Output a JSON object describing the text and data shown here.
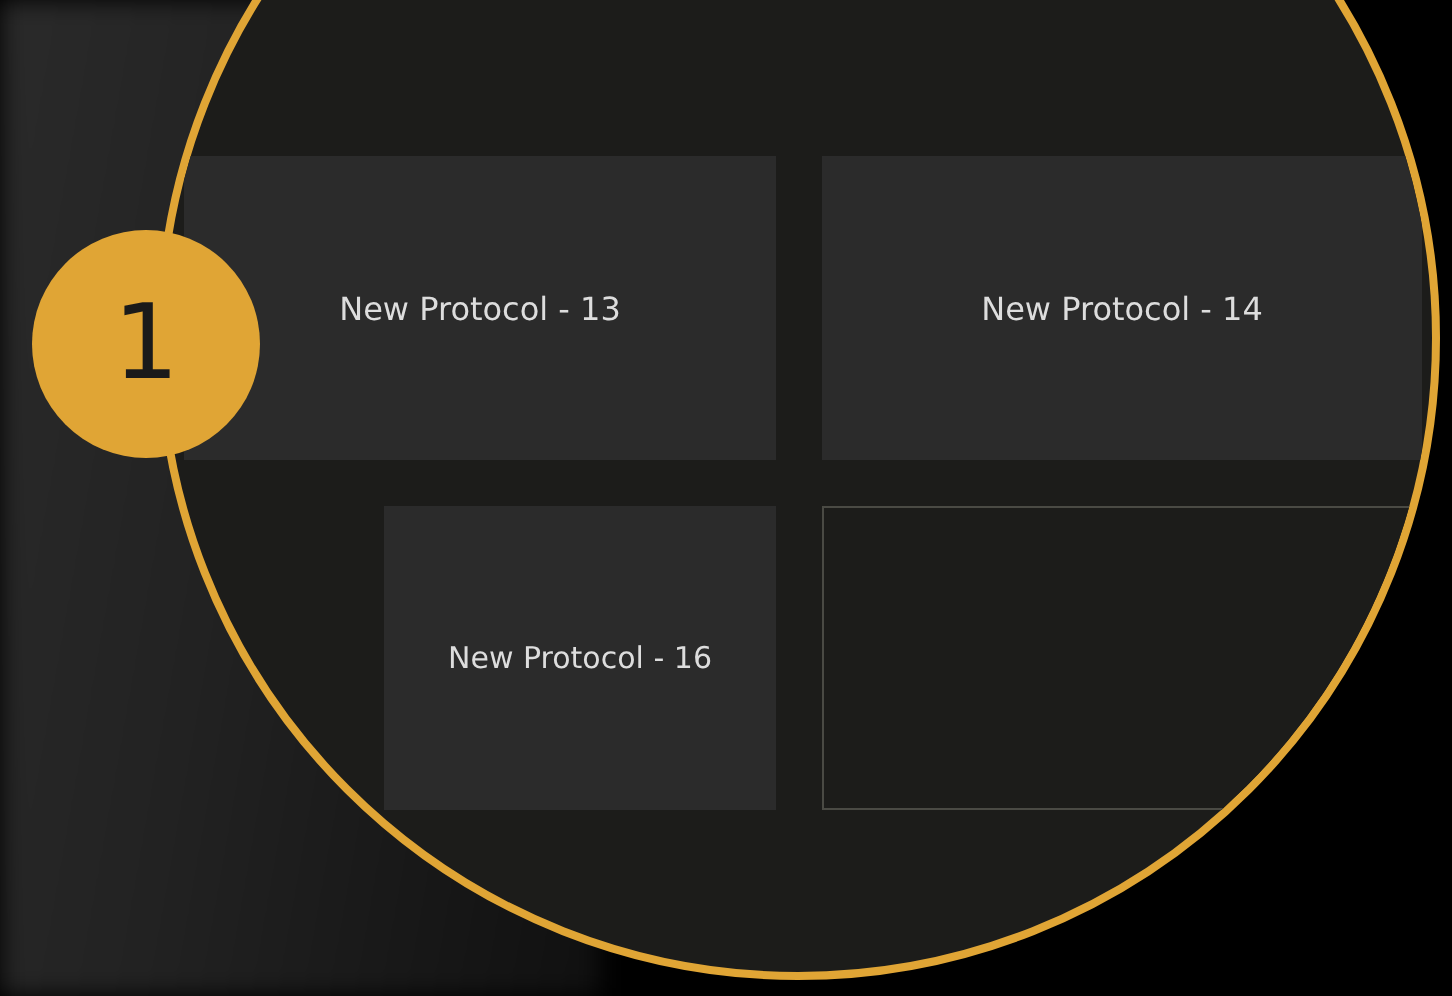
{
  "callout": {
    "number": "1"
  },
  "tiles": [
    {
      "kind": "protocol",
      "label": "New Protocol - 13"
    },
    {
      "kind": "protocol",
      "label": "New Protocol - 14"
    },
    {
      "kind": "protocol",
      "label": "New Protocol - 16"
    },
    {
      "kind": "empty"
    }
  ]
}
